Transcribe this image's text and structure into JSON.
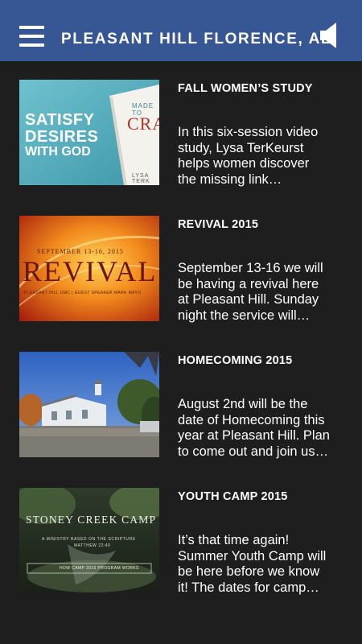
{
  "header": {
    "title": "PLEASANT HILL FLORENCE, AL",
    "menu_icon": "hamburger-menu-icon",
    "sound_icon": "speaker-icon"
  },
  "posts": [
    {
      "title": "FALL WOMEN’S STUDY",
      "excerpt": "In this six-session video\nstudy, Lysa TerKeurst\nhelps women discover\nthe missing link…",
      "thumb": {
        "line1": "SATISFY",
        "line2": "DESIRES",
        "line3": "WITH GOD",
        "book_top": "MADE TO",
        "book_main": "CRAV",
        "book_author": "LYSA TERK"
      }
    },
    {
      "title": "REVIVAL 2015",
      "excerpt": "September 13-16 we will\nbe having a revival here\nat Pleasant Hill.  Sunday\nnight the service will…",
      "thumb": {
        "dates": "SEPTEMBER 13-16, 2015",
        "word": "REVIVAL",
        "sub": "PLEASANT HILL UMC | GUEST SPEAKER MARK MAYO"
      }
    },
    {
      "title": "HOMECOMING 2015",
      "excerpt": "August 2nd will be the\ndate of Homecoming this\nyear at Pleasant Hill. Plan\nto come out and join us…",
      "thumb": {}
    },
    {
      "title": "YOUTH CAMP 2015",
      "excerpt": "It’s that time again!\nSummer Youth Camp will\nbe here before we know\nit! The dates for camp…",
      "thumb": {
        "camp": "STONEY CREEK CAMP",
        "tagline": "A MINISTRY BASED ON THE SCRIPTURE",
        "verse": "MATTHEW 22:40",
        "button": "HOW CAMP 2015 PROGRAM WORKS"
      }
    }
  ]
}
